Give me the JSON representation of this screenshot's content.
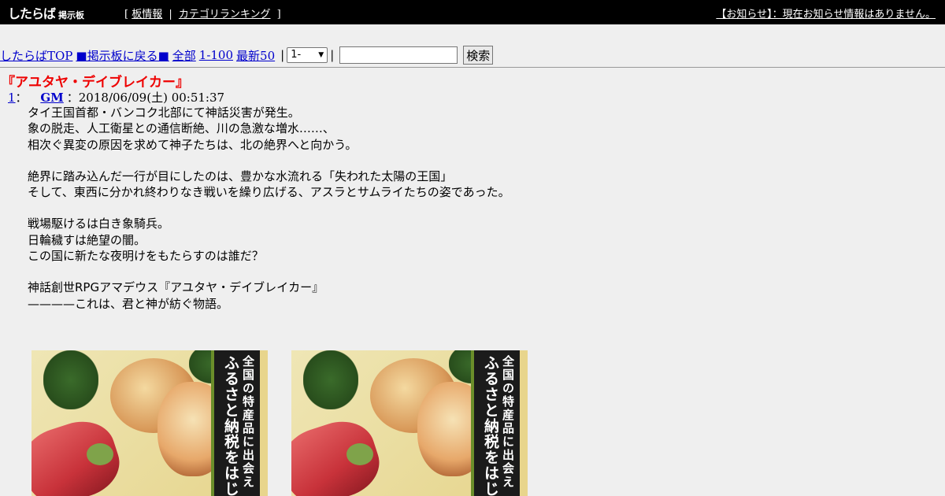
{
  "header": {
    "logo_main": "したらば",
    "logo_sub": "掲示板",
    "link_bracket_open": "[",
    "link_board_info": "板情報",
    "link_separator": "|",
    "link_category_ranking": "カテゴリランキング",
    "link_bracket_close": "]",
    "notice": "【お知らせ】：現在お知らせ情報はありません。"
  },
  "nav": {
    "top_link": "したらばTOP",
    "back_link": "■掲示板に戻る■",
    "all_link": "全部",
    "range_link": "1-100",
    "latest_link": "最新50",
    "pipe": "|",
    "range_select_value": "1-",
    "search_input_value": "",
    "search_button": "検索"
  },
  "thread": {
    "title": "『アユタヤ・デイブレイカー』",
    "post": {
      "number": "1",
      "number_suffix": "：",
      "author": "GM",
      "datetime": "：2018/06/09(土) 00:51:37",
      "paragraphs": [
        [
          "タイ王国首都・バンコク北部にて神話災害が発生。",
          "象の脱走、人工衛星との通信断絶、川の急激な増水……、",
          "相次ぐ異変の原因を求めて神子たちは、北の絶界へと向かう。"
        ],
        [
          "絶界に踏み込んだ一行が目にしたのは、豊かな水流れる「失われた太陽の王国」",
          "そして、東西に分かれ終わりなき戦いを繰り広げる、アスラとサムライたちの姿であった。"
        ],
        [
          "戦場駆けるは白き象騎兵。",
          "日輪穢すは絶望の闇。",
          "この国に新たな夜明けをもたらすのは誰だ？"
        ],
        [
          "神話創世RPGアマデウス『アユタヤ・デイブレイカー』",
          "————これは、君と神が紡ぐ物語。"
        ]
      ]
    }
  },
  "ads": [
    {
      "line1": "全国の特産品に出会え",
      "line2": "ふるさと納税をはじ"
    },
    {
      "line1": "全国の特産品に出会え",
      "line2": "ふるさと納税をはじ"
    }
  ],
  "colors": {
    "topbar": "#000000",
    "background": "#efefef",
    "link": "#0000cc",
    "thread_title": "#ee0000"
  }
}
